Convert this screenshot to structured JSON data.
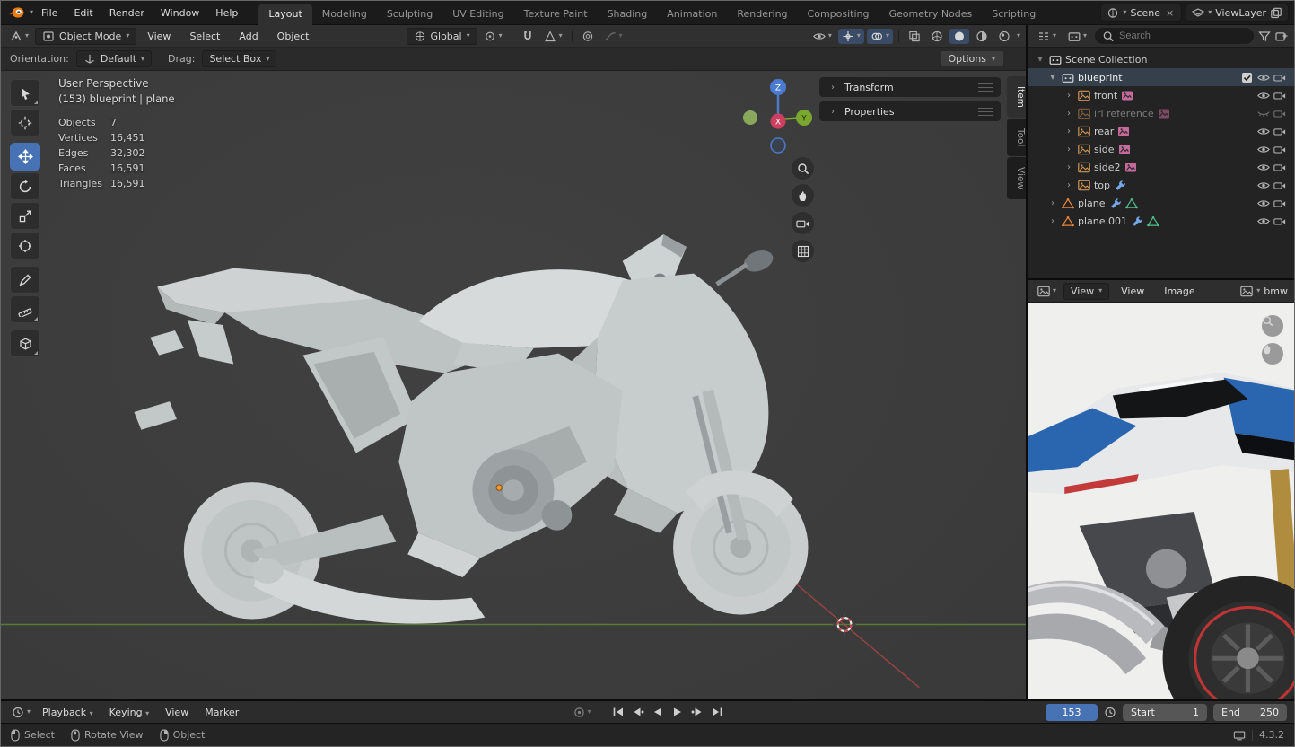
{
  "icons": {
    "chevron": "▾",
    "expand": "›",
    "close": "×",
    "check": "✓"
  },
  "colors": {
    "accent": "#4772b3",
    "axis_x_red": "#a64545",
    "axis_y_green": "#5f7f39",
    "selection_orange": "#e8853b"
  },
  "topbar": {
    "menus": [
      "File",
      "Edit",
      "Render",
      "Window",
      "Help"
    ],
    "tabs": [
      "Layout",
      "Modeling",
      "Sculpting",
      "UV Editing",
      "Texture Paint",
      "Shading",
      "Animation",
      "Rendering",
      "Compositing",
      "Geometry Nodes",
      "Scripting"
    ],
    "scene": "Scene",
    "viewlayer": "ViewLayer"
  },
  "viewport": {
    "header": {
      "mode": "Object Mode",
      "menus": [
        "View",
        "Select",
        "Add",
        "Object"
      ],
      "orientation": "Global"
    },
    "tool_settings": {
      "orientation_label": "Orientation:",
      "orientation_value": "Default",
      "drag_label": "Drag:",
      "drag_value": "Select Box",
      "options": "Options"
    },
    "overlay": {
      "title": "User Perspective",
      "subtitle": "(153) blueprint | plane",
      "stats": [
        {
          "label": "Objects",
          "value": "7"
        },
        {
          "label": "Vertices",
          "value": "16,451"
        },
        {
          "label": "Edges",
          "value": "32,302"
        },
        {
          "label": "Faces",
          "value": "16,591"
        },
        {
          "label": "Triangles",
          "value": "16,591"
        }
      ]
    },
    "gizmo": {
      "z": "Z",
      "x": "X",
      "y": "Y"
    },
    "npanel": {
      "sections": [
        {
          "label": "Transform"
        },
        {
          "label": "Properties"
        }
      ],
      "tabs": [
        {
          "label": "Item"
        },
        {
          "label": "Tool"
        },
        {
          "label": "View"
        }
      ]
    }
  },
  "outliner": {
    "search_placeholder": "Search",
    "rows": [
      {
        "label": "Scene Collection"
      },
      {
        "label": "blueprint"
      },
      {
        "label": "front"
      },
      {
        "label": "irl reference"
      },
      {
        "label": "rear"
      },
      {
        "label": "side"
      },
      {
        "label": "side2"
      },
      {
        "label": "top"
      },
      {
        "label": "plane"
      },
      {
        "label": "plane.001"
      }
    ]
  },
  "image_editor": {
    "mode": "View",
    "menus": [
      "View",
      "Image"
    ],
    "datablock": "bmw"
  },
  "timeline": {
    "playback": "Playback",
    "keying": "Keying",
    "menus": [
      "View",
      "Marker"
    ],
    "current_frame": "153",
    "start_label": "Start",
    "start_value": "1",
    "end_label": "End",
    "end_value": "250"
  },
  "statusbar": {
    "hints": [
      "Select",
      "Rotate View",
      "Object"
    ],
    "version": "4.3.2"
  }
}
